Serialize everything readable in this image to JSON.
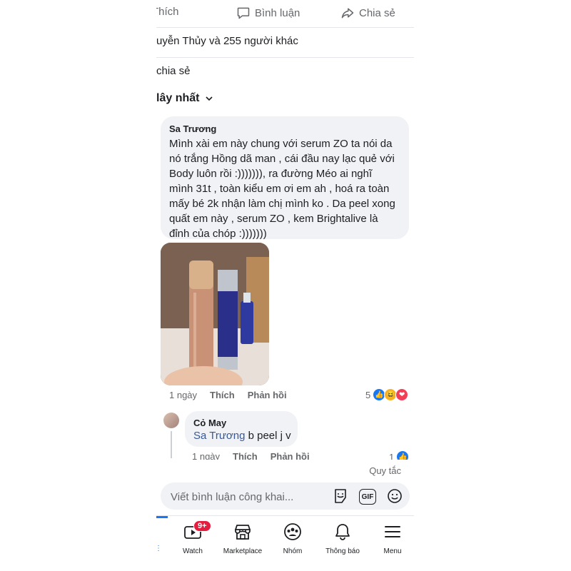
{
  "actions": {
    "like_label": "Thích",
    "comment_label": "Bình luận",
    "share_label": "Chia sẻ"
  },
  "post_stats": {
    "reactors": "uyễn Thủy và 255 người khác",
    "shares": "chia sẻ"
  },
  "sort": {
    "label": "lây nhất"
  },
  "comment": {
    "author": "Sa Trương",
    "text": "Mình xài em này chung với serum ZO ta nói da\nnó trắng Hồng dã man , cái đầu nay lạc quẻ với\nBody luôn rồi :))))))), ra đường Méo ai nghĩ\nmình 31t , toàn kiểu em ơi em ah , hoá ra toàn\nmấy bé 2k nhận làm chị mình ko . Da peel xong\nquất em này , serum ZO , kem Brightalive là\nđỉnh của chóp :)))))))",
    "time": "1 ngày",
    "like": "Thích",
    "reply": "Phản hồi",
    "reaction_count": "5",
    "reaction_icons": [
      "like-icon",
      "haha-icon",
      "love-icon"
    ]
  },
  "reply_comment": {
    "author": "Cỏ May",
    "mention": "Sa Trương",
    "text": "b peel j v",
    "time": "1 ngày",
    "like": "Thích",
    "reply": "Phản hồi",
    "reaction_count": "1"
  },
  "rules_link": "Quy tắc",
  "composer": {
    "placeholder": "Viết bình luận công khai...",
    "gif_label": "GIF"
  },
  "bottom_nav": {
    "items": [
      {
        "label": "Watch",
        "badge": "9+"
      },
      {
        "label": "Marketplace"
      },
      {
        "label": "Nhóm"
      },
      {
        "label": "Thông báo"
      },
      {
        "label": "Menu"
      }
    ]
  },
  "colors": {
    "accent": "#1877f2",
    "secondary_text": "#65676b",
    "bubble_bg": "#f0f2f5",
    "badge_red": "#e41e3f"
  }
}
